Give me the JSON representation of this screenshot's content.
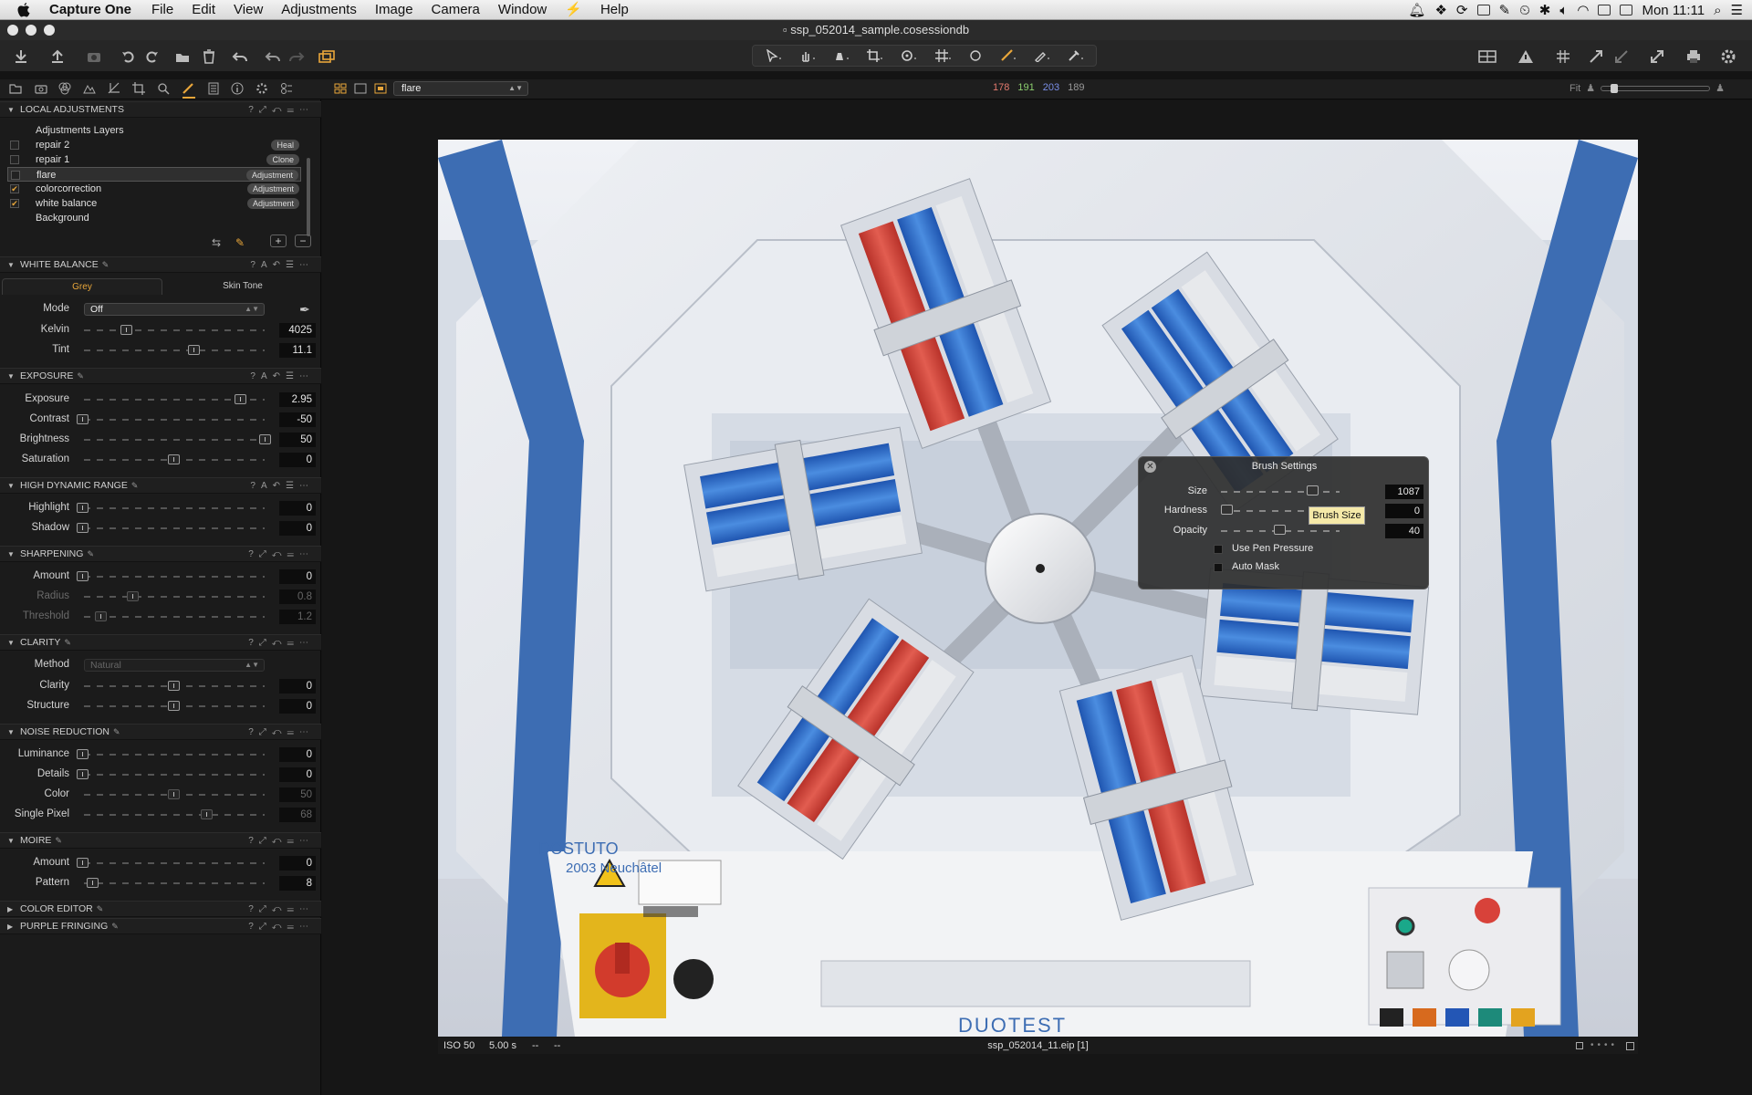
{
  "menubar": {
    "app_name": "Capture One",
    "items": [
      "File",
      "Edit",
      "View",
      "Adjustments",
      "Image",
      "Camera",
      "Window",
      "Help"
    ],
    "clock": "Mon 11:11"
  },
  "window": {
    "title": "ssp_052014_sample.cosessiondb"
  },
  "subbar": {
    "layer_select": "flare",
    "rgb": {
      "r": "178",
      "g": "191",
      "b": "203",
      "l": "189"
    },
    "fit_label": "Fit"
  },
  "local_adjustments": {
    "title": "LOCAL ADJUSTMENTS",
    "layers_label": "Adjustments Layers",
    "layers": [
      {
        "name": "repair 2",
        "tag": "Heal",
        "checked": false
      },
      {
        "name": "repair 1",
        "tag": "Clone",
        "checked": false
      },
      {
        "name": "flare",
        "tag": "Adjustment",
        "checked": false
      },
      {
        "name": "colorcorrection",
        "tag": "Adjustment",
        "checked": true
      },
      {
        "name": "white balance",
        "tag": "Adjustment",
        "checked": true
      },
      {
        "name": "Background",
        "tag": "",
        "checked": false
      }
    ]
  },
  "white_balance": {
    "title": "WHITE BALANCE",
    "tab_grey": "Grey",
    "tab_skin": "Skin Tone",
    "mode_label": "Mode",
    "mode_value": "Off",
    "kelvin_label": "Kelvin",
    "kelvin": "4025",
    "tint_label": "Tint",
    "tint": "11.1"
  },
  "exposure": {
    "title": "EXPOSURE",
    "exposure_label": "Exposure",
    "exposure": "2.95",
    "contrast_label": "Contrast",
    "contrast": "-50",
    "brightness_label": "Brightness",
    "brightness": "50",
    "saturation_label": "Saturation",
    "saturation": "0"
  },
  "hdr": {
    "title": "HIGH DYNAMIC RANGE",
    "highlight_label": "Highlight",
    "highlight": "0",
    "shadow_label": "Shadow",
    "shadow": "0"
  },
  "sharpening": {
    "title": "SHARPENING",
    "amount_label": "Amount",
    "amount": "0",
    "radius_label": "Radius",
    "radius": "0.8",
    "threshold_label": "Threshold",
    "threshold": "1.2"
  },
  "clarity": {
    "title": "CLARITY",
    "method_label": "Method",
    "method": "Natural",
    "clarity_label": "Clarity",
    "clarity": "0",
    "structure_label": "Structure",
    "structure": "0"
  },
  "noise": {
    "title": "NOISE REDUCTION",
    "luminance_label": "Luminance",
    "luminance": "0",
    "details_label": "Details",
    "details": "0",
    "color_label": "Color",
    "color": "50",
    "single_pixel_label": "Single Pixel",
    "single_pixel": "68"
  },
  "moire": {
    "title": "MOIRE",
    "amount_label": "Amount",
    "amount": "0",
    "pattern_label": "Pattern",
    "pattern": "8"
  },
  "color_editor": {
    "title": "COLOR EDITOR"
  },
  "purple_fringing": {
    "title": "PURPLE FRINGING"
  },
  "brush_settings": {
    "title": "Brush Settings",
    "size_label": "Size",
    "size": "1087",
    "hardness_label": "Hardness",
    "hardness": "0",
    "opacity_label": "Opacity",
    "opacity": "40",
    "pen_pressure": "Use Pen Pressure",
    "auto_mask": "Auto Mask",
    "tooltip": "Brush Size"
  },
  "infobar": {
    "iso": "ISO 50",
    "shutter": "5.00 s",
    "aperture": "--",
    "focal": "--",
    "filename": "ssp_052014_11.eip [1]"
  },
  "photo": {
    "plate_line1": "DOSTUTO",
    "plate_line2": "2003 Neuchâtel",
    "brand": "DUOTEST"
  },
  "colors": {
    "accent": "#e8a63a",
    "r": "#e37a6e",
    "g": "#8ccf6f",
    "b": "#7a8fe8",
    "blue_box": "#2f6fc8",
    "red_box": "#d8473c"
  }
}
